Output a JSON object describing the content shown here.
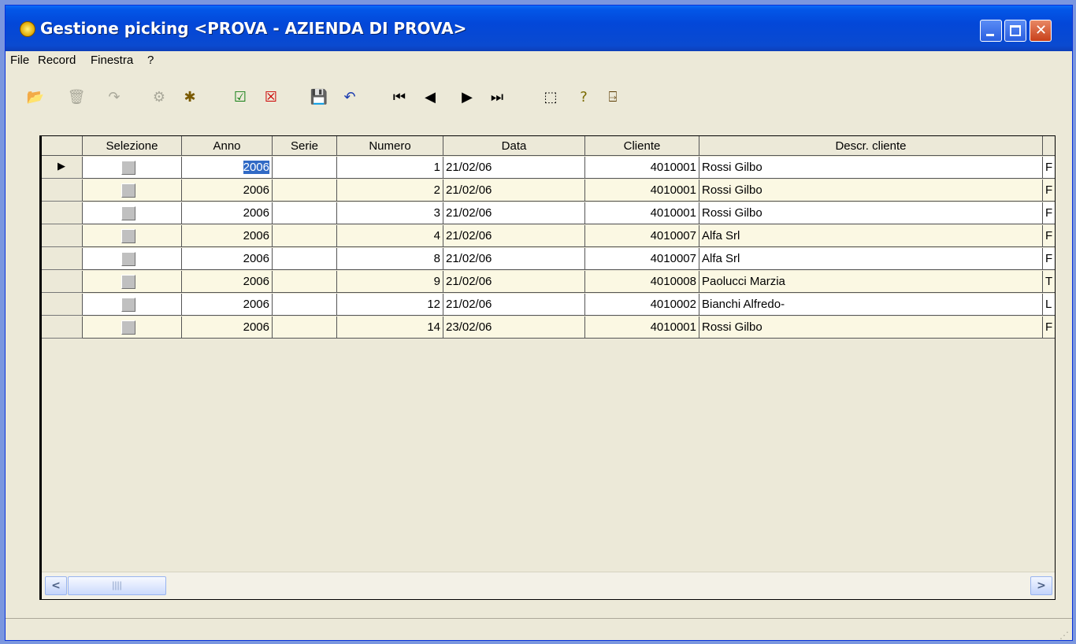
{
  "window": {
    "title": "Gestione picking <PROVA - AZIENDA DI PROVA>"
  },
  "menu": [
    {
      "label": "File"
    },
    {
      "label": "Record"
    },
    {
      "label": "Finestra"
    },
    {
      "label": "?"
    }
  ],
  "toolbar": {
    "icons": [
      "open-folder-icon",
      "delete-icon",
      "redo-icon",
      "properties-icon",
      "process-icon",
      "confirm-icon",
      "cancel-icon",
      "save-icon",
      "undo-icon",
      "first-record-icon",
      "previous-record-icon",
      "next-record-icon",
      "last-record-icon",
      "select-area-icon",
      "help-icon",
      "exit-icon"
    ]
  },
  "grid": {
    "columns": [
      "Selezione",
      "Anno",
      "Serie",
      "Numero",
      "Data",
      "Cliente",
      "Descr. cliente"
    ],
    "rows": [
      {
        "anno": "2006",
        "serie": "",
        "numero": "1",
        "data": "21/02/06",
        "cliente": "4010001",
        "descr": "Rossi Gilbo",
        "extra": "F"
      },
      {
        "anno": "2006",
        "serie": "",
        "numero": "2",
        "data": "21/02/06",
        "cliente": "4010001",
        "descr": "Rossi Gilbo",
        "extra": "F"
      },
      {
        "anno": "2006",
        "serie": "",
        "numero": "3",
        "data": "21/02/06",
        "cliente": "4010001",
        "descr": "Rossi Gilbo",
        "extra": "F"
      },
      {
        "anno": "2006",
        "serie": "",
        "numero": "4",
        "data": "21/02/06",
        "cliente": "4010007",
        "descr": "Alfa Srl",
        "extra": "F"
      },
      {
        "anno": "2006",
        "serie": "",
        "numero": "8",
        "data": "21/02/06",
        "cliente": "4010007",
        "descr": "Alfa Srl",
        "extra": "F"
      },
      {
        "anno": "2006",
        "serie": "",
        "numero": "9",
        "data": "21/02/06",
        "cliente": "4010008",
        "descr": "Paolucci Marzia",
        "extra": "T"
      },
      {
        "anno": "2006",
        "serie": "",
        "numero": "12",
        "data": "21/02/06",
        "cliente": "4010002",
        "descr": "Bianchi Alfredo-",
        "extra": "L"
      },
      {
        "anno": "2006",
        "serie": "",
        "numero": "14",
        "data": "23/02/06",
        "cliente": "4010001",
        "descr": "Rossi Gilbo",
        "extra": "F"
      }
    ]
  },
  "colors": {
    "title_bar": "#0347d8",
    "row_alt": "#fbf8e3",
    "selection": "#316ac5"
  }
}
